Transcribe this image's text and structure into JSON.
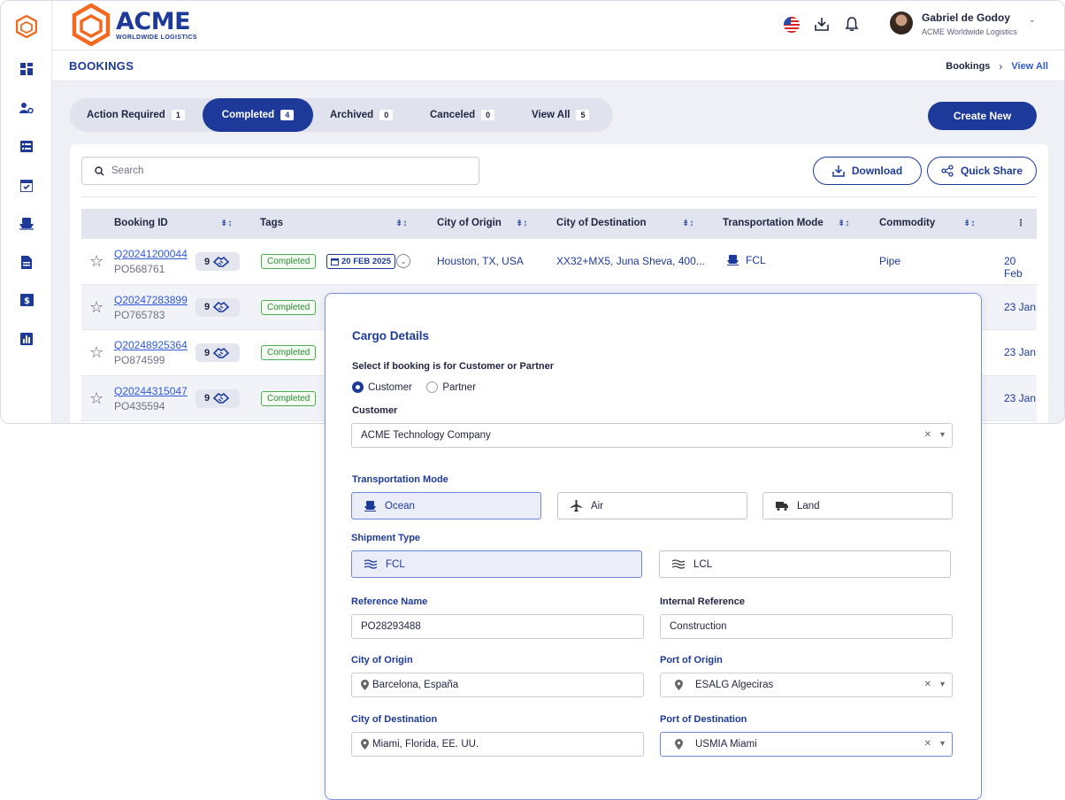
{
  "app": {
    "logo_title": "ACME",
    "logo_subtitle": "WORLDWIDE LOGISTICS",
    "user_name": "Gabriel de Godoy",
    "user_company": "ACME Worldwide Logistics",
    "accent_color": "#1d3a9a"
  },
  "sidebar": {
    "icons": [
      "dashboard-icon",
      "users-settings-icon",
      "list-icon",
      "calendar-check-icon",
      "ship-icon",
      "document-icon",
      "dollar-icon",
      "bar-chart-icon"
    ]
  },
  "header": {
    "title": "BOOKINGS",
    "breadcrumb": [
      "Bookings",
      "View All"
    ]
  },
  "tabs": [
    {
      "label": "Action Required",
      "count": "1"
    },
    {
      "label": "Completed",
      "count": "4"
    },
    {
      "label": "Archived",
      "count": "0"
    },
    {
      "label": "Canceled",
      "count": "0"
    },
    {
      "label": "View All",
      "count": "5"
    }
  ],
  "actions": {
    "create_new": "Create New",
    "download": "Download",
    "quick_share": "Quick Share",
    "search_placeholder": "Search"
  },
  "table": {
    "columns": [
      "Booking ID",
      "Tags",
      "City of Origin",
      "City of Destination",
      "Transportation Mode",
      "Commodity"
    ],
    "rows": [
      {
        "id": "Q20241200044",
        "po": "PO568761",
        "badge": "9",
        "tag": "Completed",
        "date_tag": "20 FEB 2025",
        "origin": "Houston, TX, USA",
        "destination": "XX32+MX5, Juna Sheva, 400...",
        "mode": "FCL",
        "commodity": "Pipe",
        "date": "20 Feb"
      },
      {
        "id": "Q20247283899",
        "po": "PO765783",
        "badge": "9",
        "tag": "Completed",
        "date": "23 Jan"
      },
      {
        "id": "Q20248925364",
        "po": "PO874599",
        "badge": "9",
        "tag": "Completed",
        "date": "23 Jan"
      },
      {
        "id": "Q20244315047",
        "po": "PO435594",
        "badge": "9",
        "tag": "Completed",
        "date": "23 Jan"
      }
    ]
  },
  "cargo": {
    "title": "Cargo Details",
    "select_label": "Select if booking is for Customer or Partner",
    "radio_customer": "Customer",
    "radio_partner": "Partner",
    "customer_label": "Customer",
    "customer_value": "ACME Technology Company",
    "transport_label": "Transportation Mode",
    "modes": [
      "Ocean",
      "Air",
      "Land"
    ],
    "shipment_label": "Shipment Type",
    "shipments": [
      "FCL",
      "LCL"
    ],
    "reference_name_label": "Reference Name",
    "reference_name": "PO28293488",
    "internal_ref_label": "Internal Reference",
    "internal_ref": "Construction",
    "city_origin_label": "City of Origin",
    "city_origin": "Barcelona, España",
    "port_origin_label": "Port of Origin",
    "port_origin": "ESALG Algeciras",
    "city_dest_label": "City of Destination",
    "city_dest": "Miami, Florida, EE. UU.",
    "port_dest_label": "Port of Destination",
    "port_dest": "USMIA Miami"
  }
}
